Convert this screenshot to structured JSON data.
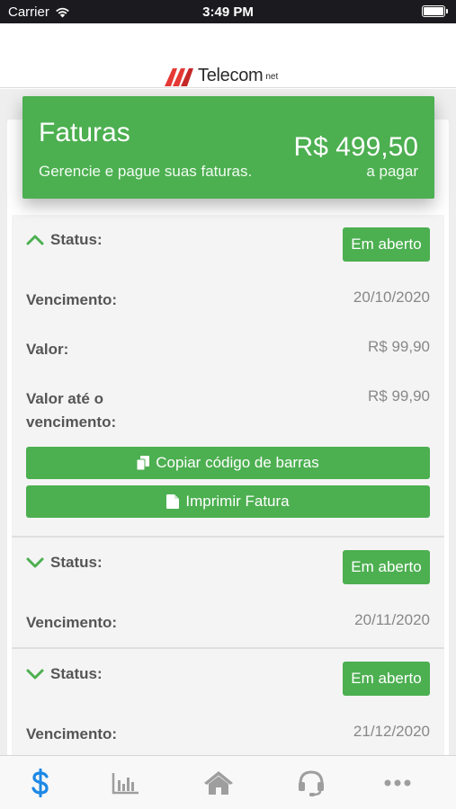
{
  "status_bar": {
    "carrier": "Carrier",
    "time": "3:49 PM"
  },
  "header": {
    "logo_word": "Telecom",
    "logo_suffix": "net"
  },
  "summary": {
    "title": "Faturas",
    "subtitle": "Gerencie e pague suas faturas.",
    "amount": "R$ 499,50",
    "amount_caption": "a pagar"
  },
  "invoices": [
    {
      "expanded": true,
      "status_label": "Status:",
      "status_value": "Em aberto",
      "due_label": "Vencimento:",
      "due_value": "20/10/2020",
      "amount_label": "Valor:",
      "amount_value": "R$ 99,90",
      "amount_due_label_1": "Valor até o",
      "amount_due_label_2": "vencimento:",
      "amount_due_value": "R$ 99,90",
      "copy_barcode_label": "Copiar código de barras",
      "print_label": "Imprimir Fatura"
    },
    {
      "expanded": false,
      "status_label": "Status:",
      "status_value": "Em aberto",
      "due_label": "Vencimento:",
      "due_value": "20/11/2020"
    },
    {
      "expanded": false,
      "status_label": "Status:",
      "status_value": "Em aberto",
      "due_label": "Vencimento:",
      "due_value": "21/12/2020"
    }
  ],
  "tab_bar": {
    "tabs": [
      {
        "icon": "dollar-icon",
        "active": true
      },
      {
        "icon": "bar-chart-icon",
        "active": false
      },
      {
        "icon": "home-icon",
        "active": false
      },
      {
        "icon": "headset-icon",
        "active": false
      },
      {
        "icon": "more-icon",
        "active": false
      }
    ]
  },
  "colors": {
    "accent": "#4caf50",
    "tab_active": "#1e88e5",
    "tab_inactive": "#9e9e9e"
  }
}
